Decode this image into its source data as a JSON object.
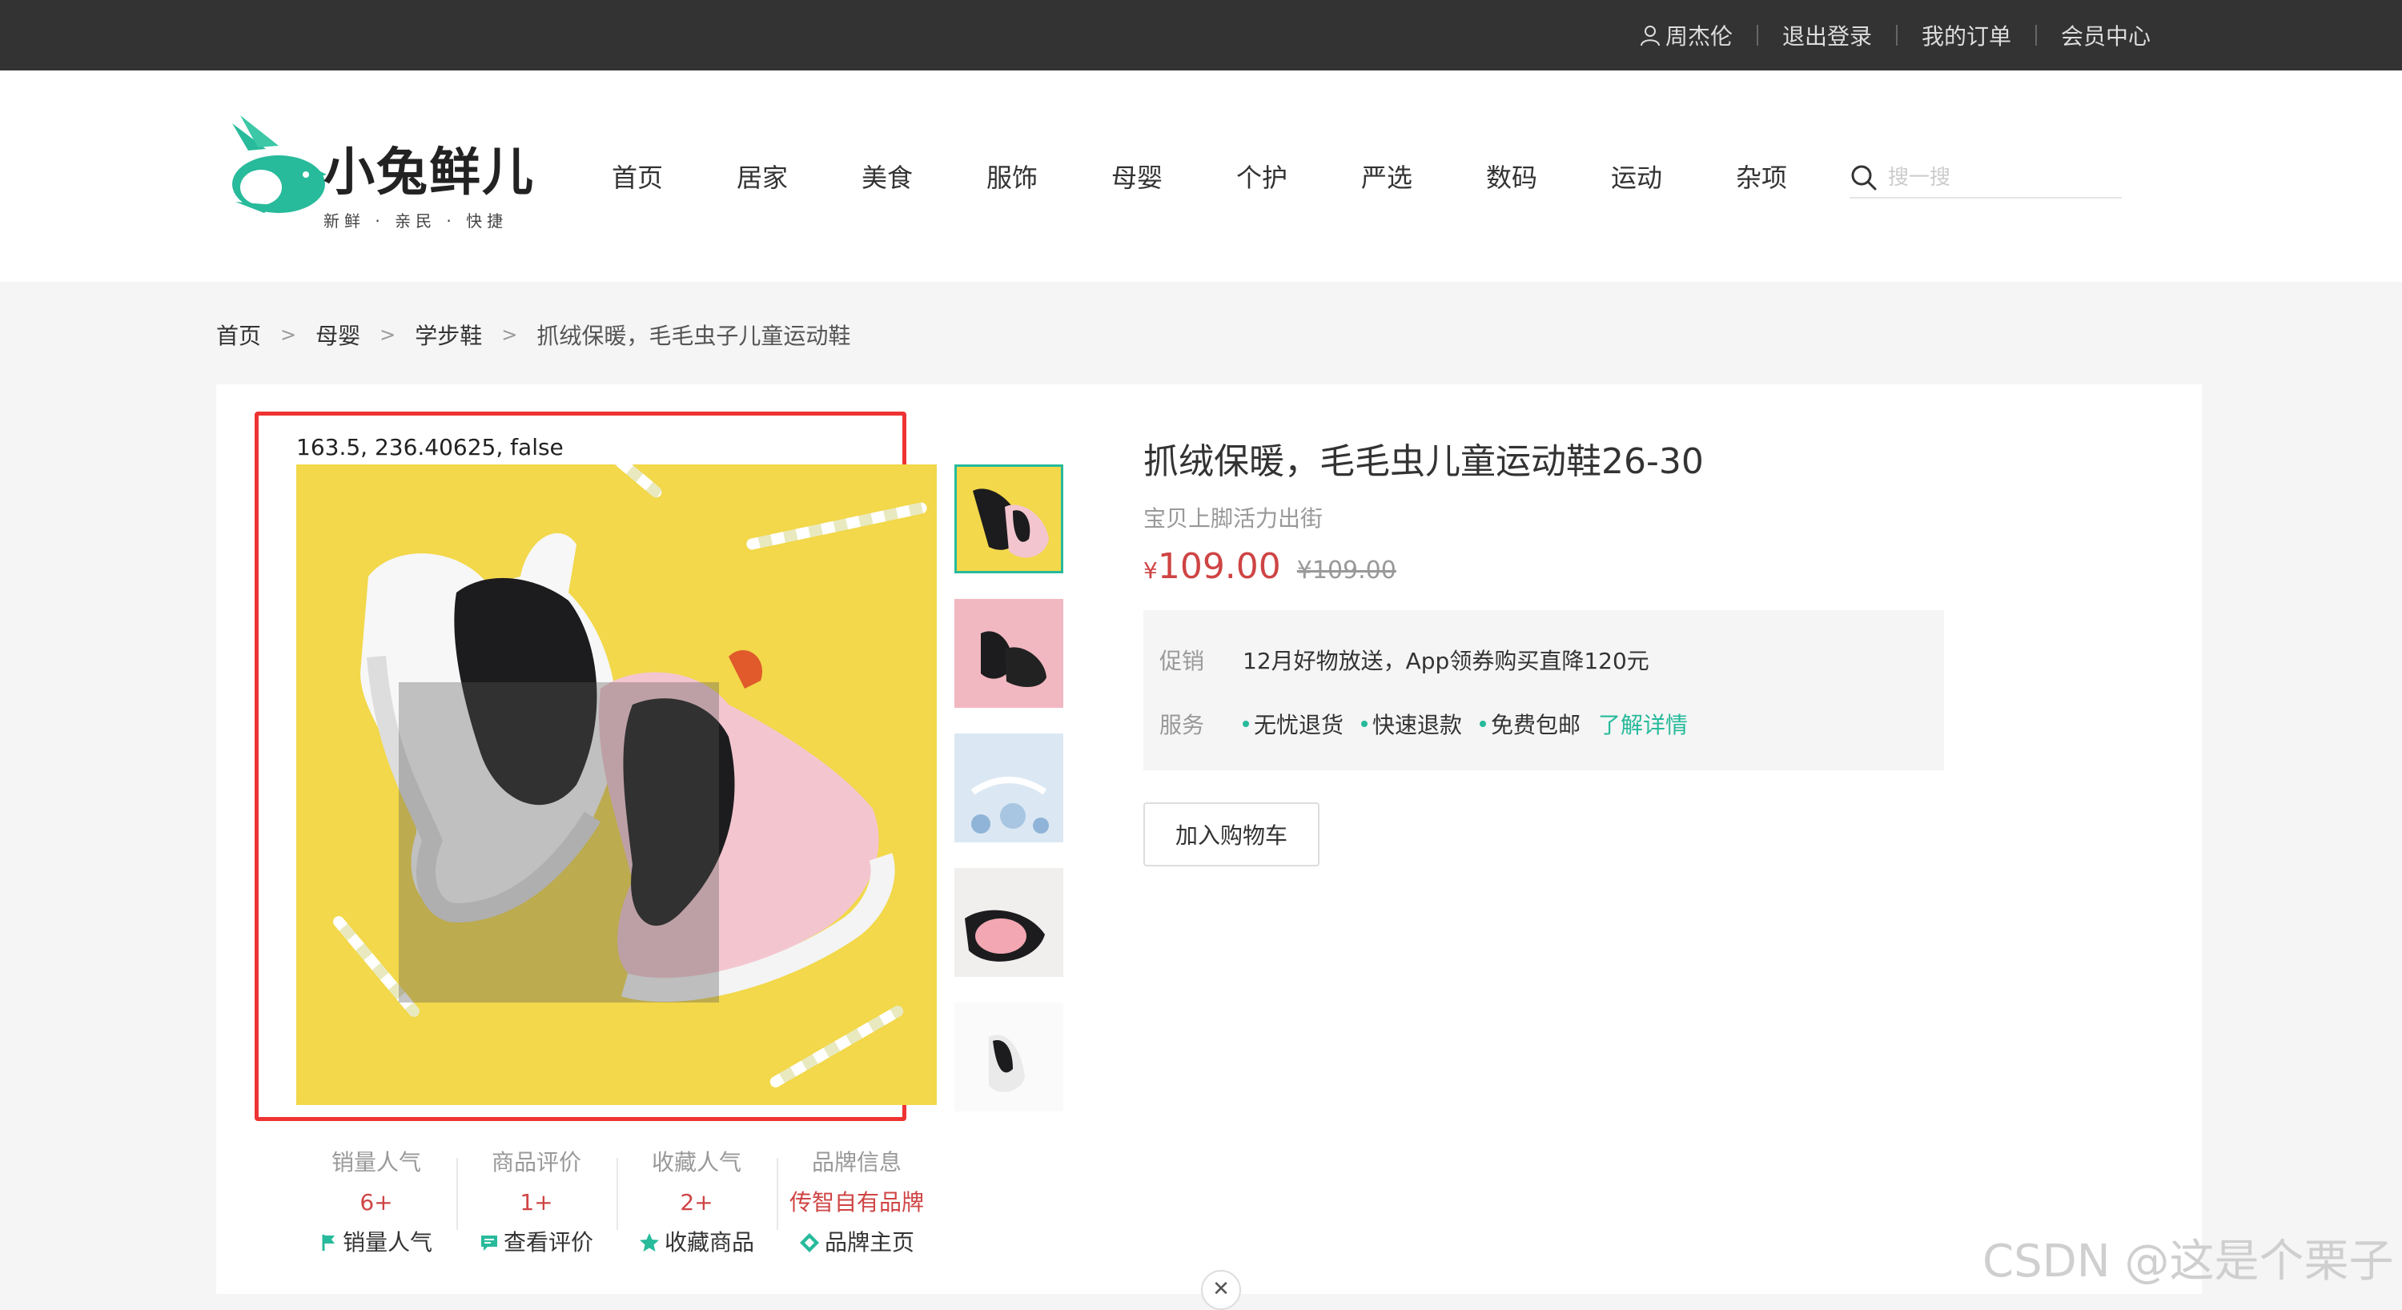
{
  "topbar": {
    "user_name": "周杰伦",
    "logout": "退出登录",
    "orders": "我的订单",
    "member": "会员中心"
  },
  "logo": {
    "name": "小兔鲜儿",
    "slogan": "新鲜 · 亲民 · 快捷"
  },
  "nav": [
    "首页",
    "居家",
    "美食",
    "服饰",
    "母婴",
    "个护",
    "严选",
    "数码",
    "运动",
    "杂项"
  ],
  "search": {
    "placeholder": "搜一搜"
  },
  "breadcrumb": [
    "首页",
    "母婴",
    "学步鞋",
    "抓绒保暖，毛毛虫子儿童运动鞋"
  ],
  "debug_text": "163.5, 236.40625, false",
  "product": {
    "title": "抓绒保暖，毛毛虫儿童运动鞋26-30",
    "subtitle": "宝贝上脚活力出街",
    "currency": "¥",
    "price": "109.00",
    "old_price": "¥109.00"
  },
  "promo": {
    "promo_key": "促销",
    "promo_text": "12月好物放送，App领券购买直降120元",
    "service_key": "服务",
    "services": [
      "无忧退货",
      "快速退款",
      "免费包邮"
    ],
    "more": "了解详情"
  },
  "cart_button": "加入购物车",
  "stats": [
    {
      "label": "销量人气",
      "value": "6+",
      "link": "销量人气",
      "icon": "flag-icon"
    },
    {
      "label": "商品评价",
      "value": "1+",
      "link": "查看评价",
      "icon": "comment-icon"
    },
    {
      "label": "收藏人气",
      "value": "2+",
      "link": "收藏商品",
      "icon": "star-icon"
    },
    {
      "label": "品牌信息",
      "value": "传智自有品牌",
      "link": "品牌主页",
      "icon": "brand-icon"
    }
  ],
  "watermark": "CSDN @这是个栗子",
  "colors": {
    "accent": "#27ba9b",
    "price": "#cf4444",
    "topbar": "#333333",
    "highlight_box": "#ee3333"
  }
}
